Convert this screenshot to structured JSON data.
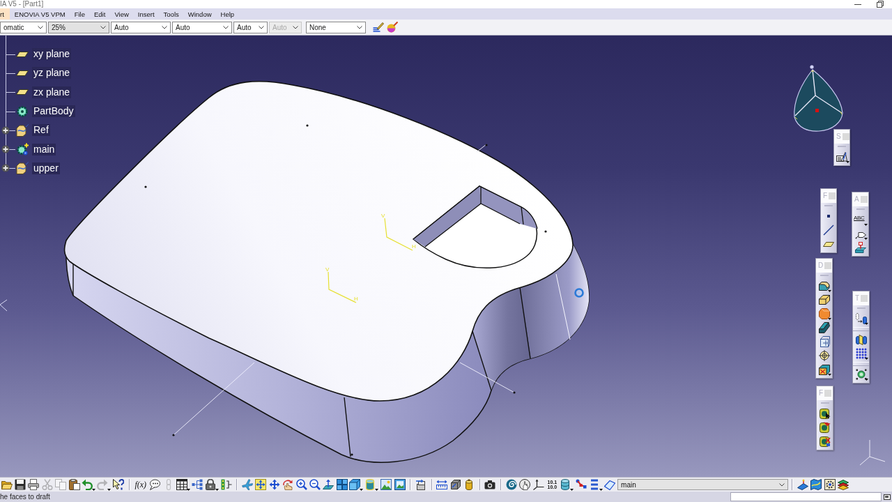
{
  "window": {
    "title": "IA V5 - [Part1]"
  },
  "menu": [
    {
      "label": "rt",
      "selected": true
    },
    {
      "label": "ENOVIA V5 VPM",
      "selected": false
    },
    {
      "label": "File",
      "selected": false
    },
    {
      "label": "Edit",
      "selected": false
    },
    {
      "label": "View",
      "selected": false
    },
    {
      "label": "Insert",
      "selected": false
    },
    {
      "label": "Tools",
      "selected": false
    },
    {
      "label": "Window",
      "selected": false
    },
    {
      "label": "Help",
      "selected": false
    }
  ],
  "toolbar": {
    "fields": [
      {
        "value": "omatic",
        "kind": "list",
        "disabled": false
      },
      {
        "value": "25%",
        "kind": "combo",
        "disabled": false
      },
      {
        "value": "Auto",
        "kind": "list",
        "disabled": false
      },
      {
        "value": "Auto",
        "kind": "list",
        "disabled": false
      },
      {
        "value": "Auto",
        "kind": "list",
        "disabled": false
      },
      {
        "value": "Auto",
        "kind": "list",
        "disabled": true
      },
      {
        "value": "None",
        "kind": "list",
        "disabled": false
      }
    ]
  },
  "viewport": {
    "tree": [
      {
        "label": "xy plane",
        "kind": "plane",
        "collapsed": false
      },
      {
        "label": "yz plane",
        "kind": "plane",
        "collapsed": false
      },
      {
        "label": "zx plane",
        "kind": "plane",
        "collapsed": false
      },
      {
        "label": "PartBody",
        "kind": "body",
        "collapsed": false
      },
      {
        "label": "Ref",
        "kind": "geoset",
        "collapsed": true
      },
      {
        "label": "main",
        "kind": "new_body",
        "collapsed": true
      },
      {
        "label": "upper",
        "kind": "geoset",
        "collapsed": true
      }
    ],
    "axis_markers": [
      {
        "labels": [
          "V",
          "H"
        ]
      },
      {
        "labels": [
          "V",
          "H"
        ]
      }
    ]
  },
  "floating_toolbars": [
    {
      "title": "S",
      "items": [
        {
          "kind": "button",
          "menu": true
        }
      ]
    },
    {
      "title": "F",
      "items": [
        {
          "kind": "button",
          "menu": false
        },
        {
          "kind": "button",
          "menu": false
        },
        {
          "kind": "button",
          "menu": false
        }
      ]
    },
    {
      "title": "A",
      "items": [
        {
          "kind": "text_button",
          "label": "ABC",
          "menu": true
        },
        {
          "kind": "button",
          "menu": true
        },
        {
          "kind": "button",
          "menu": false
        }
      ]
    },
    {
      "title": "D",
      "items": [
        {
          "kind": "button",
          "menu": true
        },
        {
          "kind": "button",
          "menu": false
        },
        {
          "kind": "button",
          "menu": true
        },
        {
          "kind": "button",
          "menu": false
        },
        {
          "kind": "button",
          "menu": false
        },
        {
          "kind": "button",
          "menu": false
        },
        {
          "kind": "button",
          "menu": true
        }
      ]
    },
    {
      "title": "T",
      "items": [
        {
          "kind": "button",
          "menu": true
        },
        {
          "kind": "separator"
        },
        {
          "kind": "button",
          "menu": false
        },
        {
          "kind": "button",
          "menu": true
        },
        {
          "kind": "separator"
        },
        {
          "kind": "button",
          "menu": true
        }
      ]
    },
    {
      "title": "F",
      "items": [
        {
          "kind": "button",
          "menu": false
        },
        {
          "kind": "button",
          "menu": false
        },
        {
          "kind": "button",
          "menu": false
        }
      ]
    }
  ],
  "bottom_toolbar": {
    "items": [
      {
        "kind": "button",
        "disabled": false,
        "menu": false
      },
      {
        "kind": "button",
        "disabled": false,
        "menu": false
      },
      {
        "kind": "button",
        "disabled": false,
        "menu": false
      },
      {
        "kind": "button",
        "disabled": true,
        "menu": false
      },
      {
        "kind": "button",
        "disabled": true,
        "menu": false
      },
      {
        "kind": "button",
        "disabled": false,
        "menu": false
      },
      {
        "kind": "button",
        "disabled": false,
        "menu": true
      },
      {
        "kind": "button",
        "disabled": true,
        "menu": true
      },
      {
        "kind": "button",
        "disabled": false,
        "menu": false
      },
      {
        "kind": "separator"
      },
      {
        "kind": "text_button",
        "label": "f(x)",
        "disabled": false,
        "menu": false
      },
      {
        "kind": "button",
        "disabled": false,
        "menu": false
      },
      {
        "kind": "button",
        "disabled": true,
        "menu": false
      },
      {
        "kind": "button",
        "disabled": false,
        "menu": true
      },
      {
        "kind": "button",
        "disabled": false,
        "menu": false
      },
      {
        "kind": "button",
        "disabled": false,
        "menu": true
      },
      {
        "kind": "button",
        "disabled": false,
        "menu": false
      },
      {
        "kind": "separator"
      },
      {
        "kind": "button",
        "disabled": false,
        "menu": false
      },
      {
        "kind": "button",
        "disabled": false,
        "menu": false
      },
      {
        "kind": "button",
        "disabled": false,
        "menu": false
      },
      {
        "kind": "button",
        "disabled": false,
        "menu": false
      },
      {
        "kind": "button",
        "disabled": false,
        "menu": false
      },
      {
        "kind": "button",
        "disabled": false,
        "menu": false
      },
      {
        "kind": "button",
        "disabled": false,
        "menu": false
      },
      {
        "kind": "button",
        "disabled": false,
        "menu": false
      },
      {
        "kind": "button",
        "disabled": false,
        "menu": true
      },
      {
        "kind": "button",
        "disabled": false,
        "menu": true
      },
      {
        "kind": "button",
        "disabled": false,
        "menu": false
      },
      {
        "kind": "button",
        "disabled": false,
        "menu": false
      },
      {
        "kind": "separator"
      },
      {
        "kind": "button",
        "disabled": false,
        "menu": false
      },
      {
        "kind": "separator"
      },
      {
        "kind": "button",
        "disabled": false,
        "menu": false
      },
      {
        "kind": "button",
        "disabled": false,
        "menu": false
      },
      {
        "kind": "button",
        "disabled": false,
        "menu": false
      },
      {
        "kind": "separator"
      },
      {
        "kind": "button",
        "disabled": false,
        "menu": false
      },
      {
        "kind": "separator"
      },
      {
        "kind": "button",
        "disabled": false,
        "menu": false
      },
      {
        "kind": "button",
        "disabled": false,
        "menu": false
      },
      {
        "kind": "button",
        "disabled": false,
        "menu": false
      },
      {
        "kind": "text_button",
        "label": "10.1 10.0",
        "disabled": false,
        "menu": false
      },
      {
        "kind": "button",
        "disabled": false,
        "menu": true
      },
      {
        "kind": "button",
        "disabled": false,
        "menu": false
      },
      {
        "kind": "button",
        "disabled": false,
        "menu": true
      },
      {
        "kind": "button",
        "disabled": false,
        "menu": false
      },
      {
        "kind": "dropdown",
        "value": "main"
      },
      {
        "kind": "separator"
      },
      {
        "kind": "button",
        "disabled": false,
        "menu": false
      },
      {
        "kind": "button",
        "disabled": false,
        "menu": false
      },
      {
        "kind": "button",
        "disabled": false,
        "menu": false
      },
      {
        "kind": "button",
        "disabled": false,
        "menu": false
      }
    ]
  },
  "status_bar": {
    "message": "he faces to draft"
  }
}
